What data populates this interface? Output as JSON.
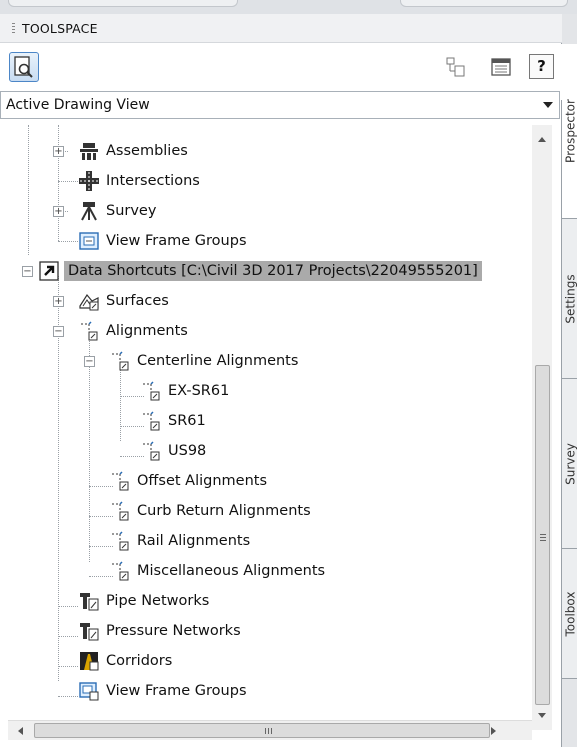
{
  "palette": "Toolspace",
  "title": "TOOLSPACE",
  "view_selector": {
    "value": "Active Drawing View"
  },
  "toolbar": {
    "help_label": "?",
    "icons": [
      "prospector-view-icon",
      "item-view-icon",
      "panorama-icon",
      "help-icon"
    ]
  },
  "tree": [
    {
      "label": "Assemblies",
      "icon": "assemblies-icon"
    },
    {
      "label": "Intersections",
      "icon": "intersections-icon"
    },
    {
      "label": "Survey",
      "icon": "survey-icon"
    },
    {
      "label": "View Frame Groups",
      "icon": "view-frame-groups-icon"
    },
    {
      "label": "Data Shortcuts [C:\\Civil 3D 2017 Projects\\22049555201]",
      "icon": "data-shortcuts-icon"
    },
    {
      "label": "Surfaces",
      "icon": "surfaces-icon"
    },
    {
      "label": "Alignments",
      "icon": "alignments-icon"
    },
    {
      "label": "Centerline Alignments",
      "icon": "alignment-shortcut-icon"
    },
    {
      "label": "EX-SR61",
      "icon": "alignment-shortcut-icon"
    },
    {
      "label": "SR61",
      "icon": "alignment-shortcut-icon"
    },
    {
      "label": "US98",
      "icon": "alignment-shortcut-icon"
    },
    {
      "label": "Offset Alignments",
      "icon": "alignment-shortcut-icon"
    },
    {
      "label": "Curb Return Alignments",
      "icon": "alignment-shortcut-icon"
    },
    {
      "label": "Rail Alignments",
      "icon": "alignment-shortcut-icon"
    },
    {
      "label": "Miscellaneous Alignments",
      "icon": "alignment-shortcut-icon"
    },
    {
      "label": "Pipe Networks",
      "icon": "pipe-networks-icon"
    },
    {
      "label": "Pressure Networks",
      "icon": "pressure-networks-icon"
    },
    {
      "label": "Corridors",
      "icon": "corridors-icon"
    },
    {
      "label": "View Frame Groups",
      "icon": "view-frame-groups-icon"
    }
  ],
  "side_tabs": [
    "Prospector",
    "Settings",
    "Survey",
    "Toolbox"
  ],
  "scrollbar": {
    "grip": "≡",
    "hgrip": "III"
  },
  "colors": {
    "selection": "#aaaaaa",
    "accent": "#4c86c7"
  }
}
